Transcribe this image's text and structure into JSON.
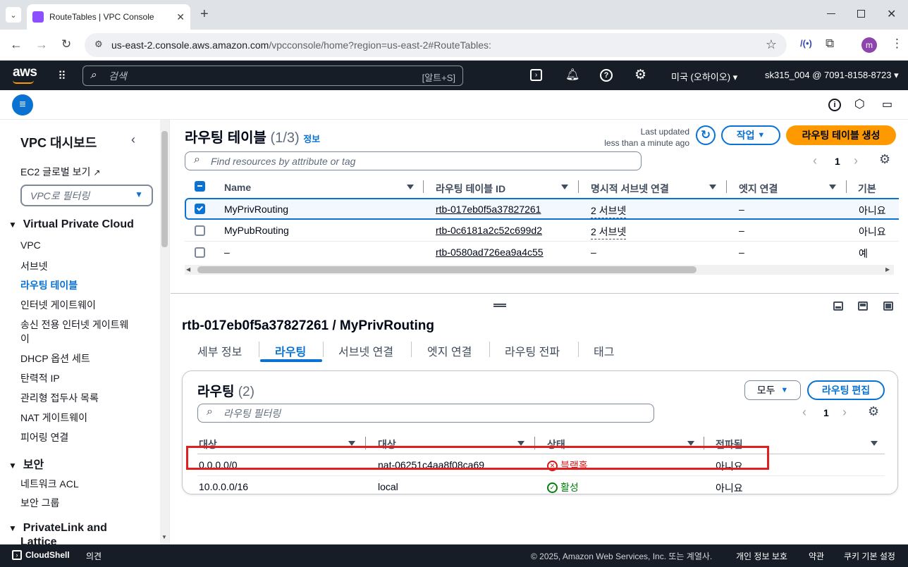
{
  "browser": {
    "tab_title": "RouteTables | VPC Console",
    "url_host": "us-east-2.console.aws.amazon.com",
    "url_path": "/vpcconsole/home?region=us-east-2#RouteTables:",
    "profile_initial": "m"
  },
  "aws_nav": {
    "logo": "aws",
    "search_placeholder": "검색",
    "search_shortcut": "[알트+S]",
    "region": "미국 (오하이오)",
    "account": "sk315_004 @ 7091-8158-8723"
  },
  "sidebar": {
    "title": "VPC 대시보드",
    "ec2_global": "EC2 글로벌 보기",
    "filter_placeholder": "VPC로 필터링",
    "section_vpc": "Virtual Private Cloud",
    "items": [
      "VPC",
      "서브넷",
      "라우팅 테이블",
      "인터넷 게이트웨이",
      "송신 전용 인터넷 게이트웨",
      "이",
      "DHCP 옵션 세트",
      "탄력적 IP",
      "관리형 접두사 목록",
      "NAT 게이트웨이",
      "피어링 연결"
    ],
    "section_security": "보안",
    "security_items": [
      "네트워크 ACL",
      "보안 그룹"
    ],
    "section_privatelink": "PrivateLink and",
    "section_privatelink2": "Lattice"
  },
  "route_tables": {
    "title": "라우팅 테이블",
    "count": "(1/3)",
    "info": "정보",
    "last_updated_label": "Last updated",
    "last_updated_value": "less than a minute ago",
    "actions_button": "작업",
    "create_button": "라우팅 테이블 생성",
    "search_placeholder": "Find resources by attribute or tag",
    "page": "1",
    "columns": [
      "Name",
      "라우팅 테이블 ID",
      "명시적 서브넷 연결",
      "엣지 연결",
      "기본"
    ],
    "rows": [
      {
        "name": "MyPrivRouting",
        "id": "rtb-017eb0f5a37827261",
        "subnets": "2 서브넷",
        "edge": "–",
        "main": "아니요",
        "selected": true
      },
      {
        "name": "MyPubRouting",
        "id": "rtb-0c6181a2c52c699d2",
        "subnets": "2 서브넷",
        "edge": "–",
        "main": "아니요",
        "selected": false
      },
      {
        "name": "–",
        "id": "rtb-0580ad726ea9a4c55",
        "subnets": "–",
        "edge": "–",
        "main": "예",
        "selected": false
      }
    ]
  },
  "detail": {
    "heading": "rtb-017eb0f5a37827261 / MyPrivRouting",
    "tabs": [
      "세부 정보",
      "라우팅",
      "서브넷 연결",
      "엣지 연결",
      "라우팅 전파",
      "태그"
    ],
    "active_tab": 1,
    "routes_title": "라우팅",
    "routes_count": "(2)",
    "filter_all": "모두",
    "edit_button": "라우팅 편집",
    "filter_placeholder": "라우팅 필터링",
    "page": "1",
    "columns": [
      "대상",
      "대상",
      "상태",
      "전파됨"
    ],
    "routes": [
      {
        "destination": "0.0.0.0/0",
        "target": "nat-06251c4aa8f08ca69",
        "status": "블랙홀",
        "propagated": "아니요",
        "status_kind": "error"
      },
      {
        "destination": "10.0.0.0/16",
        "target": "local",
        "status": "활성",
        "propagated": "아니요",
        "status_kind": "ok"
      }
    ]
  },
  "footer": {
    "cloudshell": "CloudShell",
    "feedback": "의견",
    "copyright": "© 2025, Amazon Web Services, Inc. 또는 계열사.",
    "privacy": "개인 정보 보호",
    "terms": "약관",
    "cookies": "쿠키 기본 설정"
  },
  "colors": {
    "link": "#0972d3",
    "primary_button": "#ff9900",
    "error": "#d91515",
    "success": "#037f0c",
    "highlight_box": "#e02020",
    "nav_bg": "#161d26"
  }
}
